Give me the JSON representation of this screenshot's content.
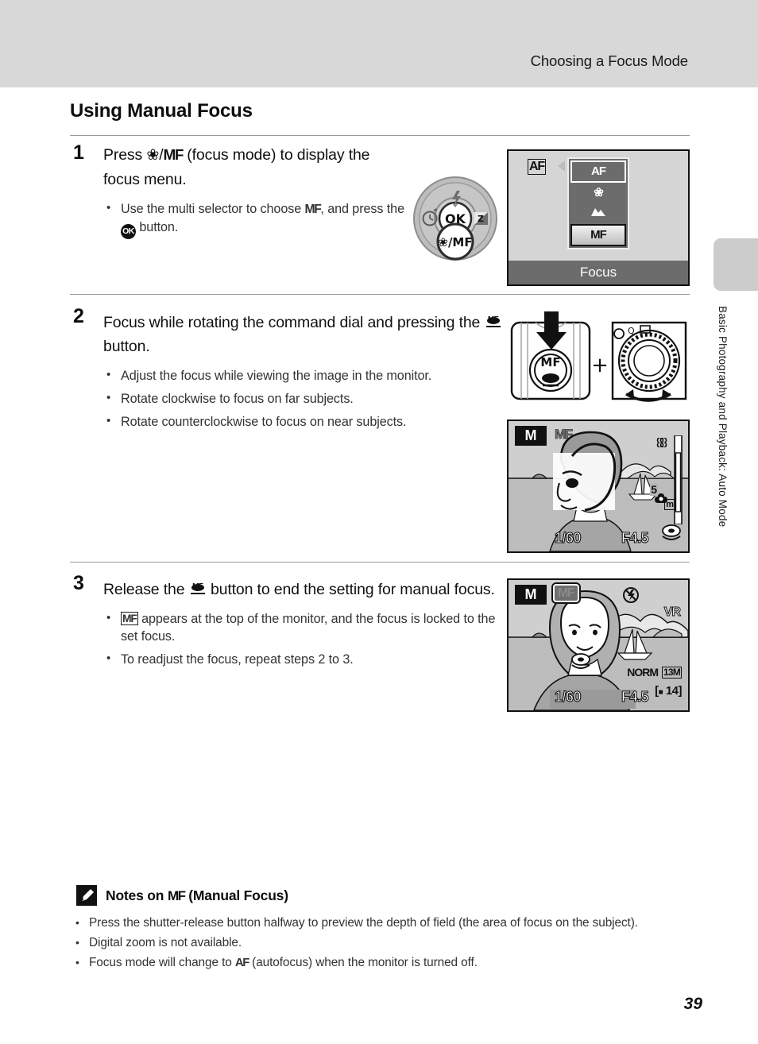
{
  "header": {
    "running_head": "Choosing a Focus Mode"
  },
  "side_tab": {
    "label": "Basic Photography and Playback: Auto Mode"
  },
  "page": {
    "title": "Using Manual Focus",
    "number": "39"
  },
  "steps": [
    {
      "number": "1",
      "heading_part1": "Press ",
      "heading_flower": "❀",
      "heading_slash": "/",
      "heading_mf": "MF",
      "heading_part2": " (focus mode) to display the focus menu.",
      "bullets": [
        {
          "pre": "Use the multi selector to choose ",
          "glyph": "MF",
          "mid": ", and press the ",
          "glyph2": "OK",
          "post": " button."
        }
      ]
    },
    {
      "number": "2",
      "heading_part1": "Focus while rotating the command dial and pressing the ",
      "heading_part2": " button.",
      "bullets": [
        "Adjust the focus while viewing the image in the monitor.",
        "Rotate clockwise to focus on far subjects.",
        "Rotate counterclockwise to focus on near subjects."
      ]
    },
    {
      "number": "3",
      "heading_part1": "Release the ",
      "heading_part2": " button to end the setting for manual focus.",
      "bullets_first": {
        "glyph": "MF",
        "text": " appears at the top of the monitor, and the focus is locked to the set focus."
      },
      "bullets_rest": [
        "To readjust the focus, repeat steps 2 to 3."
      ]
    }
  ],
  "focus_menu": {
    "badge": "AF",
    "items": [
      "AF",
      "flower-icon",
      "mountain-icon",
      "MF"
    ],
    "selected": "MF",
    "caption": "Focus"
  },
  "button_figure": {
    "mf_button_label": "MF",
    "plus": "+"
  },
  "monitor_step2": {
    "mode": "M",
    "focus_indicator": "MF",
    "shutter_speed": "1/60",
    "aperture": "F4.5",
    "distance_value": "5",
    "distance_unit": "m"
  },
  "monitor_step3": {
    "mode": "M",
    "focus_indicator": "MF",
    "flash_off_icon": "flash-off-icon",
    "vr": "VR",
    "shutter_speed": "1/60",
    "aperture": "F4.5",
    "quality": "NORM",
    "image_size": "13M",
    "shots_remaining": "14"
  },
  "notes": {
    "icon": "pencil-note-icon",
    "title_pre": "Notes on ",
    "title_glyph": "MF",
    "title_post": " (Manual Focus)",
    "items": [
      "Press the shutter-release button halfway to preview the depth of field (the area of focus on the subject).",
      "Digital zoom is not available."
    ],
    "last_item_pre": "Focus mode will change to ",
    "last_item_glyph": "AF",
    "last_item_post": " (autofocus) when the monitor is turned off."
  },
  "colors": {
    "header_band": "#d8d8d8",
    "side_tab": "#cccccc",
    "lcd_bg": "#d5d5d5",
    "menu_bg": "#6c6c6c"
  }
}
